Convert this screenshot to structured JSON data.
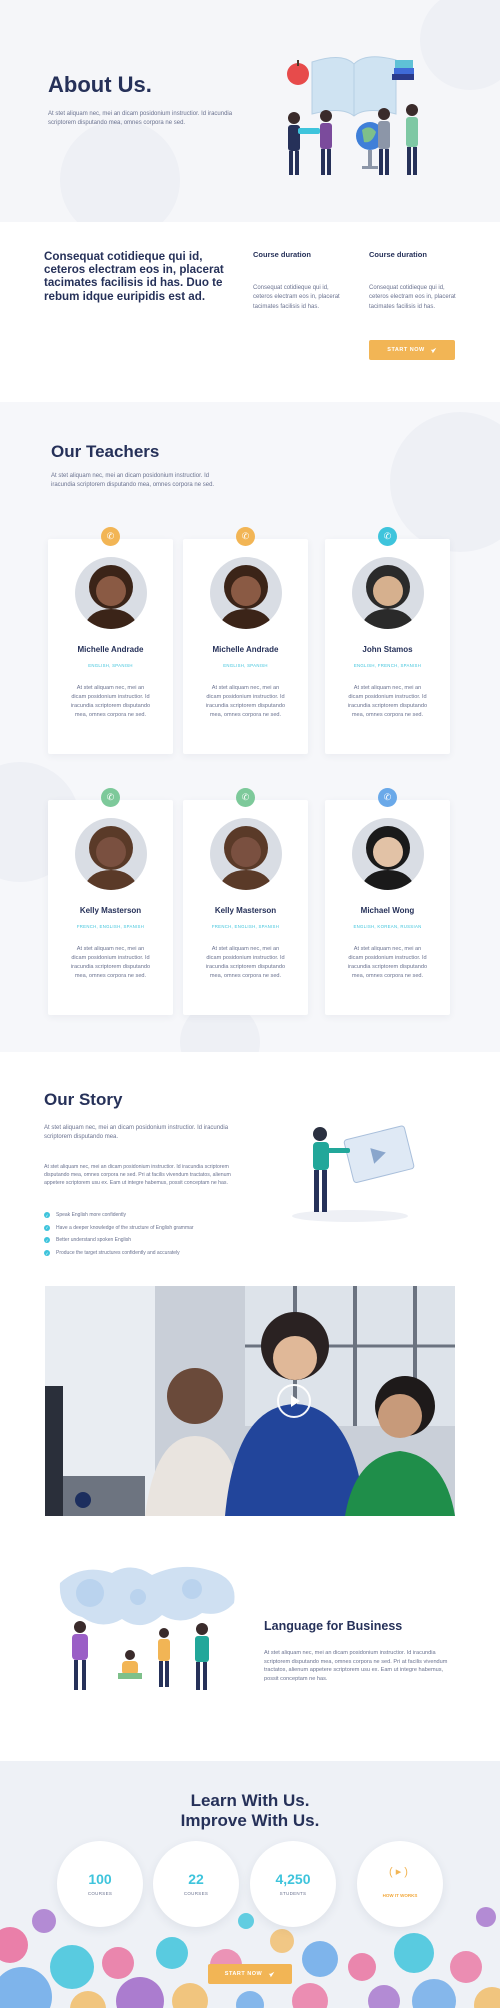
{
  "about": {
    "title": "About Us.",
    "text": "At stet aliquam nec, mei an dicam posidonium instructior. Id iracundia scriptorem disputando mea, omnes corpora ne sed."
  },
  "duration": {
    "headline": "Consequat cotidieque qui id, ceteros electram eos in, placerat tacimates facilisis id has. Duo te rebum idque euripidis est ad.",
    "col1_title": "Course duration",
    "col1_text": "Consequat cotidieque qui id, ceteros electram eos in, placerat tacimates facilisis id has.",
    "col2_title": "Course duration",
    "col2_text": "Consequat cotidieque qui id, ceteros electram eos in, placerat tacimates facilisis id has.",
    "button": "START NOW"
  },
  "teachers": {
    "title": "Our Teachers",
    "intro": "At stet aliquam nec, mei an dicam posidonium instructior. Id iracundia scriptorem disputando mea, omnes corpora ne sed.",
    "cards": [
      {
        "name": "Michelle Andrade",
        "langs": "ENGLISH, SPANISH",
        "desc": "At stet aliquam nec, mei an dicam posidonium instructior. Id iracundia scriptorem disputando mea, omnes corpora ne sed.",
        "badge_icon": "whatsapp-icon",
        "badge_color": "#f2b555"
      },
      {
        "name": "Michelle Andrade",
        "langs": "ENGLISH, SPANISH",
        "desc": "At stet aliquam nec, mei an dicam posidonium instructior. Id iracundia scriptorem disputando mea, omnes corpora ne sed.",
        "badge_icon": "whatsapp-icon",
        "badge_color": "#f2b555"
      },
      {
        "name": "John Stamos",
        "langs": "ENGLISH, FRENCH, SPANISH",
        "desc": "At stet aliquam nec, mei an dicam posidonium instructior. Id iracundia scriptorem disputando mea, omnes corpora ne sed.",
        "badge_icon": "skype-icon",
        "badge_color": "#3ec4dc"
      },
      {
        "name": "Kelly Masterson",
        "langs": "FRENCH, ENGLISH, SPANISH",
        "desc": "At stet aliquam nec, mei an dicam posidonium instructior. Id iracundia scriptorem disputando mea, omnes corpora ne sed.",
        "badge_icon": "whatsapp-icon",
        "badge_color": "#7dc99a"
      },
      {
        "name": "Kelly Masterson",
        "langs": "FRENCH, ENGLISH, SPANISH",
        "desc": "At stet aliquam nec, mei an dicam posidonium instructior. Id iracundia scriptorem disputando mea, omnes corpora ne sed.",
        "badge_icon": "whatsapp-icon",
        "badge_color": "#7dc99a"
      },
      {
        "name": "Michael Wong",
        "langs": "ENGLISH, KOREAN, RUSSIAN",
        "desc": "At stet aliquam nec, mei an dicam posidonium instructior. Id iracundia scriptorem disputando mea, omnes corpora ne sed.",
        "badge_icon": "wechat-icon",
        "badge_color": "#6aa9e9"
      }
    ]
  },
  "story": {
    "title": "Our Story",
    "lead": "At stet aliquam nec, mei an dicam posidonium instructior. Id iracundia scriptorem disputando mea.",
    "body": "At stet aliquam nec, mei an dicam posidonium instructior. Id iracundia scriptorem disputando mea, omnes corpora ne sed. Pri at facilis vivendum tractatos, alienum appetere scriptorem usu ex. Eam ut integre habemus, possit conceptam ne has.",
    "bullets": [
      "Speak English more confidently",
      "Have a deeper knowledge of the structure of English grammar",
      "Better understand spoken English",
      "Produce the target structures confidently and accurately"
    ]
  },
  "language": {
    "title": "Language for Business",
    "text": "At stet aliquam nec, mei an dicam posidonium instructior. Id iracundia scriptorem disputando mea, omnes corpora ne sed. Pri at facilis vivendum tractatos, alienum appetere scriptorem usu ex. Eam ut integre habemus, possit conceptam ne has."
  },
  "learn": {
    "title_line1": "Learn With Us.",
    "title_line2": "Improve With Us.",
    "stats": [
      {
        "num": "100",
        "label": "COURSES"
      },
      {
        "num": "22",
        "label": "COURSES"
      },
      {
        "num": "4,250",
        "label": "STUDENTS"
      }
    ],
    "works_label": "HOW IT WORKS",
    "button": "START NOW"
  },
  "colors": {
    "navy": "#263159",
    "accent_cyan": "#3ec4dc",
    "accent_orange": "#f2b555"
  }
}
